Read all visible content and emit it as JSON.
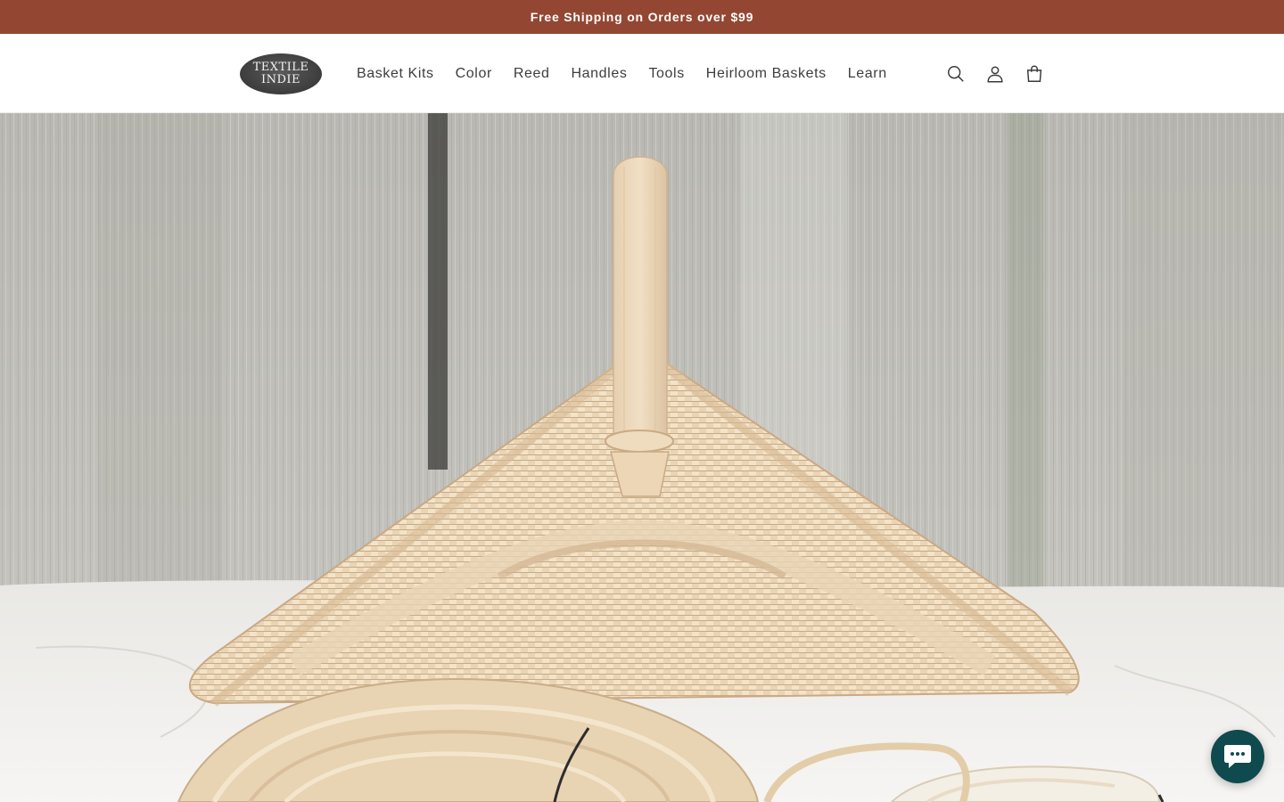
{
  "announcement": {
    "text": "Free Shipping on Orders over $99"
  },
  "header": {
    "logo": {
      "line1": "TEXTILE",
      "line2": "INDIE"
    },
    "nav": [
      {
        "label": "Basket Kits"
      },
      {
        "label": "Color"
      },
      {
        "label": "Reed"
      },
      {
        "label": "Handles"
      },
      {
        "label": "Tools"
      },
      {
        "label": "Heirloom Baskets"
      },
      {
        "label": "Learn"
      }
    ],
    "icons": [
      "search-icon",
      "account-icon",
      "cart-icon"
    ]
  },
  "hero": {
    "image": "woven-reed-basket-with-wooden-handle-and-reed-coils"
  },
  "chat": {
    "icon": "chat-bubble-icon"
  },
  "colors": {
    "announcement_bg": "#934733",
    "text": "#3a3a3a",
    "chat_bg": "#0f4a4f"
  }
}
